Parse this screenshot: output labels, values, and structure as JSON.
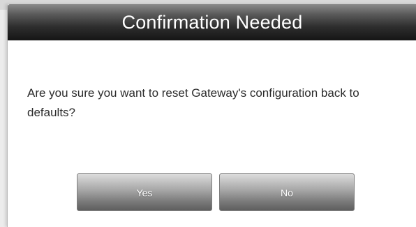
{
  "dialog": {
    "title": "Confirmation Needed",
    "message": "Are you sure you want to reset Gateway's configuration back to defaults?",
    "buttons": {
      "yes_label": "Yes",
      "no_label": "No"
    }
  },
  "colors": {
    "titlebar": "#151515",
    "title_text": "#ffffff",
    "message_text": "#2b2b2b",
    "button": "#8a8a8a",
    "background": "#ffffff"
  }
}
